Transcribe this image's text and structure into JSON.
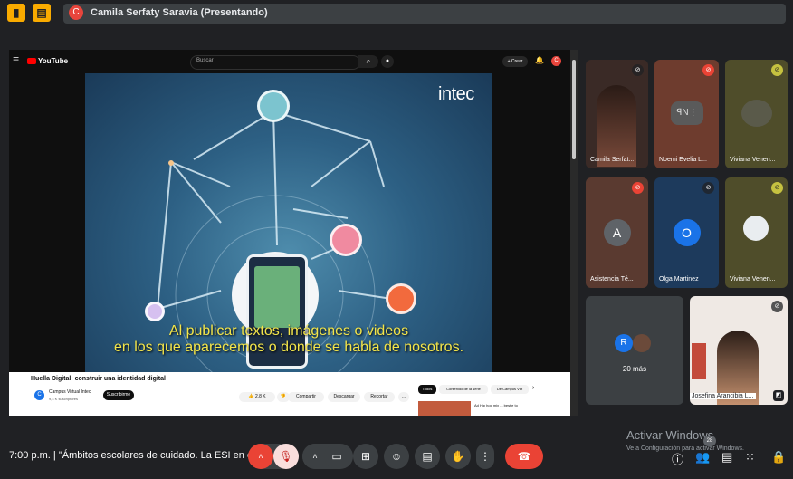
{
  "topbar": {
    "presenter_initial": "C",
    "presenter_label": "Camila Serfaty Saravia (Presentando)"
  },
  "youtube": {
    "logo": "YouTube",
    "search_placeholder": "Buscar",
    "create_label": "+ Crear",
    "avatar_initial": "C",
    "video_brand": "intec",
    "subtitle_line1": "Al publicar textos, imágenes o videos",
    "subtitle_line2": "en los que aparecemos o donde se habla de nosotros.",
    "video_title": "Huella Digital: construir una identidad digital",
    "channel_initial": "C",
    "channel_name": "Campus Virtual Intec",
    "channel_subs": "9,4 K suscriptores",
    "subscribe_label": "Suscribirme",
    "likes": "2,8 K",
    "share_label": "Compartir",
    "download_label": "Descargar",
    "clip_label": "Recortar",
    "chips": [
      "Todos",
      "Contenido de la serie",
      "De Campus Virt"
    ],
    "side_video_title": "Ad Hip hop mix ... bestie to"
  },
  "participants": [
    {
      "name": "Camila Serfat...",
      "type": "video"
    },
    {
      "name": "Noemi Evelia L...",
      "type": "avatar"
    },
    {
      "name": "Viviana Venen...",
      "type": "avatar"
    },
    {
      "name": "Asistencia Té...",
      "type": "letter",
      "letter": "A",
      "color": "#5f6368"
    },
    {
      "name": "Olga Martinez",
      "type": "letter",
      "letter": "O",
      "color": "#1a73e8"
    },
    {
      "name": "Viviana Venen...",
      "type": "avatar"
    },
    {
      "name": "20 más",
      "type": "more",
      "letter": "R"
    },
    {
      "name": "Josefina Arancibia L...",
      "type": "video"
    }
  ],
  "bottombar": {
    "meeting_info": "7:00 p.m.  |  \"Ámbitos escolares de cuidado. La ESI en es...",
    "activate_title": "Activar Windows",
    "activate_sub": "Ve a Configuración para activar Windows.",
    "people_count": "28"
  },
  "colors": {
    "hangup": "#ea4335",
    "mic_off": "#ea4335",
    "accent_yellow": "#f9ab00"
  }
}
